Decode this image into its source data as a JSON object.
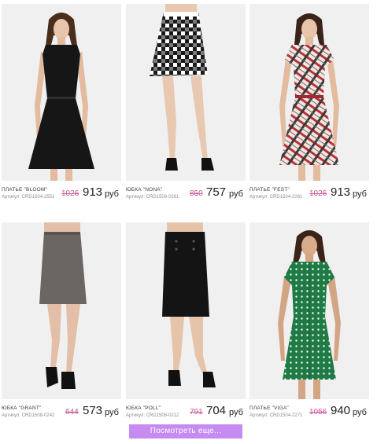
{
  "products": [
    {
      "name": "ПЛАТЬЕ \"BLOOM\"",
      "sku": "Артикул: CRD1504-2551",
      "old_price": "1026",
      "price": "913",
      "currency": "руб",
      "image": "black-dress-photo"
    },
    {
      "name": "ЮБКА \"NONA\"",
      "sku": "Артикул: CRD1508-0261",
      "old_price": "850",
      "price": "757",
      "currency": "руб",
      "image": "checked-skirt-photo"
    },
    {
      "name": "ПЛАТЬЕ \"FEST\"",
      "sku": "Артикул: CRD1504-2261",
      "old_price": "1026",
      "price": "913",
      "currency": "руб",
      "image": "plaid-dress-photo"
    },
    {
      "name": "ЮБКА \"GRANT\"",
      "sku": "Артикул: CRD1508-0242",
      "old_price": "644",
      "price": "573",
      "currency": "руб",
      "image": "grey-skirt-photo"
    },
    {
      "name": "ЮБКА \"POLL\"",
      "sku": "Артикул: CRD1508-0212",
      "old_price": "791",
      "price": "704",
      "currency": "руб",
      "image": "black-skirt-photo"
    },
    {
      "name": "ПЛАТЬЕ \"VIGA\"",
      "sku": "Артикул: CRD1504-2271",
      "old_price": "1056",
      "price": "940",
      "currency": "руб",
      "image": "green-polka-dress-photo"
    }
  ],
  "more_button": "Посмотреть еще...",
  "colors": {
    "old_price": "#c9569a",
    "button": "#c58bf0",
    "photo_background": "#efefef"
  }
}
